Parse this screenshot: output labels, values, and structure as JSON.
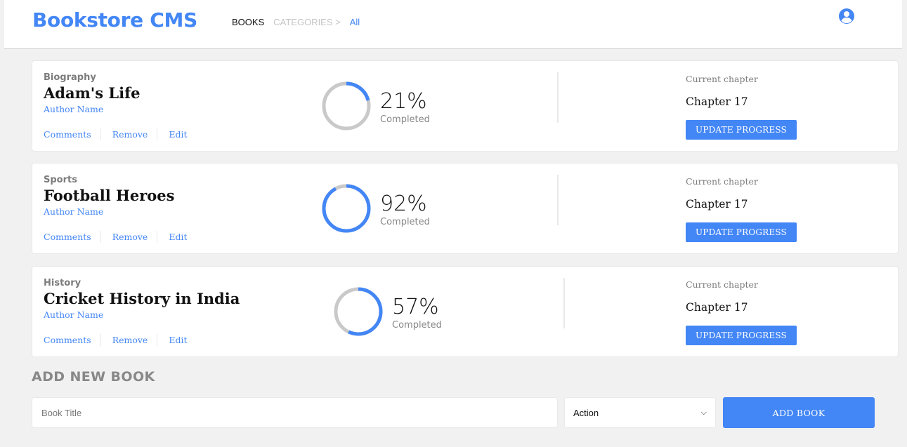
{
  "header": {
    "brand": "Bookstore CMS",
    "nav": {
      "books": "BOOKS",
      "categories": "CATEGORIES >",
      "all": "All"
    },
    "user_icon": "user-circle-icon"
  },
  "books": [
    {
      "genre": "Biography",
      "title": "Adam's Life",
      "author": "Author Name",
      "progress_percent": 21,
      "progress_label": "21%",
      "completed_label": "Completed",
      "current_chapter_label": "Current chapter",
      "chapter": "Chapter 17",
      "update_label": "UPDATE PROGRESS",
      "actions": [
        "Comments",
        "Remove",
        "Edit"
      ]
    },
    {
      "genre": "Sports",
      "title": "Football Heroes",
      "author": "Author Name",
      "progress_percent": 92,
      "progress_label": "92%",
      "completed_label": "Completed",
      "current_chapter_label": "Current chapter",
      "chapter": "Chapter 17",
      "update_label": "UPDATE PROGRESS",
      "actions": [
        "Comments",
        "Remove",
        "Edit"
      ]
    },
    {
      "genre": "History",
      "title": "Cricket History in India",
      "author": "Author Name",
      "progress_percent": 57,
      "progress_label": "57%",
      "completed_label": "Completed",
      "current_chapter_label": "Current chapter",
      "chapter": "Chapter 17",
      "update_label": "UPDATE PROGRESS",
      "actions": [
        "Comments",
        "Remove",
        "Edit"
      ]
    }
  ],
  "add_book": {
    "heading": "ADD NEW BOOK",
    "title_placeholder": "Book Title",
    "category_selected": "Action",
    "button_label": "ADD BOOK"
  },
  "colors": {
    "accent": "#4386f5",
    "track": "#c9c9c9",
    "muted": "#888888"
  }
}
